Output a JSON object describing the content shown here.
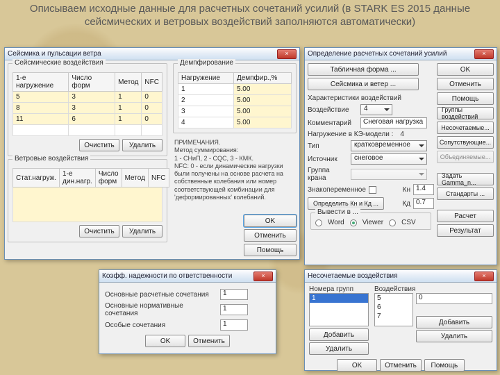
{
  "heading": "Описываем исходные данные для расчетных сочетаний усилий (в STARK ES 2015 данные сейсмических и ветровых воздействий заполняются автоматически)",
  "seismic": {
    "title": "Сейсмика и пульсации ветра",
    "fs1": "Сейсмические воздействия",
    "cols": [
      "1-е нагружение",
      "Число форм",
      "Метод",
      "NFC"
    ],
    "rows": [
      [
        "5",
        "3",
        "1",
        "0"
      ],
      [
        "8",
        "3",
        "1",
        "0"
      ],
      [
        "11",
        "6",
        "1",
        "0"
      ]
    ],
    "clear": "Очистить",
    "delete": "Удалить",
    "fs2": "Ветровые воздействия",
    "cols2": [
      "Стат.нагруж.",
      "1-е дин.нагр.",
      "Число форм",
      "Метод",
      "NFC"
    ],
    "fs3": "Демпфирование",
    "dcols": [
      "Нагружение",
      "Демпфир.,%"
    ],
    "drows": [
      [
        "1",
        "5.00"
      ],
      [
        "2",
        "5.00"
      ],
      [
        "3",
        "5.00"
      ],
      [
        "4",
        "5.00"
      ]
    ],
    "notes": "ПРИМЕЧАНИЯ.\nМетод суммирования:\n1 - СНиП, 2 - CQC, 3 - КМК.\nNFC: 0 - если динамические нагрузки были получены на основе расчета на собственные колебания или номер соответствующей комбинации для 'деформированных' колебаний.",
    "ok": "OK",
    "cancel": "Отменить",
    "help": "Помощь"
  },
  "coeff": {
    "title": "Коэфф. надежности по ответственности",
    "r1": "Основные расчетные сочетания",
    "v1": "1",
    "r2": "Основные нормативные сочетания",
    "v2": "1",
    "r3": "Особые сочетания",
    "v3": "1",
    "ok": "OK",
    "cancel": "Отменить"
  },
  "rsu": {
    "title": "Определение расчетных сочетаний усилий",
    "b_table": "Табличная форма ...",
    "b_seis": "Сейсмика и ветер ...",
    "hchar": "Характеристики воздействий",
    "l_voz": "Воздействие",
    "v_voz": "4",
    "l_com": "Комментарий",
    "v_com": "Снеговая нагрузка",
    "l_nke": "Нагружение в КЭ-модели :",
    "v_nke": "4",
    "l_tip": "Тип",
    "v_tip": "кратковременное",
    "l_src": "Источник",
    "v_src": "снеговое",
    "l_grk": "Группа крана",
    "l_znak": "Знакопеременное",
    "l_kn": "Кн",
    "v_kn": "1.4",
    "l_kd": "Кд",
    "v_kd": "0.7",
    "b_knkd": "Определить Кн и Кд ...",
    "out": "Вывести в ...",
    "o1": "Word",
    "o2": "Viewer",
    "o3": "CSV",
    "ok": "OK",
    "cancel": "Отменить",
    "help": "Помощь",
    "b_groups": "Группы воздействий",
    "b_nes": "Несочетаемые...",
    "b_sop": "Сопутствующие...",
    "b_obe": "Объединяемые...",
    "b_gamma": "Задать Gamma_n...",
    "b_std": "Стандарты ...",
    "b_calc": "Расчет",
    "b_res": "Результат"
  },
  "nes": {
    "title": "Несочетаемые воздействия",
    "l_groups": "Номера групп",
    "l_voz": "Воздействия",
    "g": [
      "1"
    ],
    "v": [
      "5",
      "6",
      "7"
    ],
    "new": "0",
    "add": "Добавить",
    "del": "Удалить",
    "ok": "OK",
    "cancel": "Отменить",
    "help": "Помощь"
  }
}
